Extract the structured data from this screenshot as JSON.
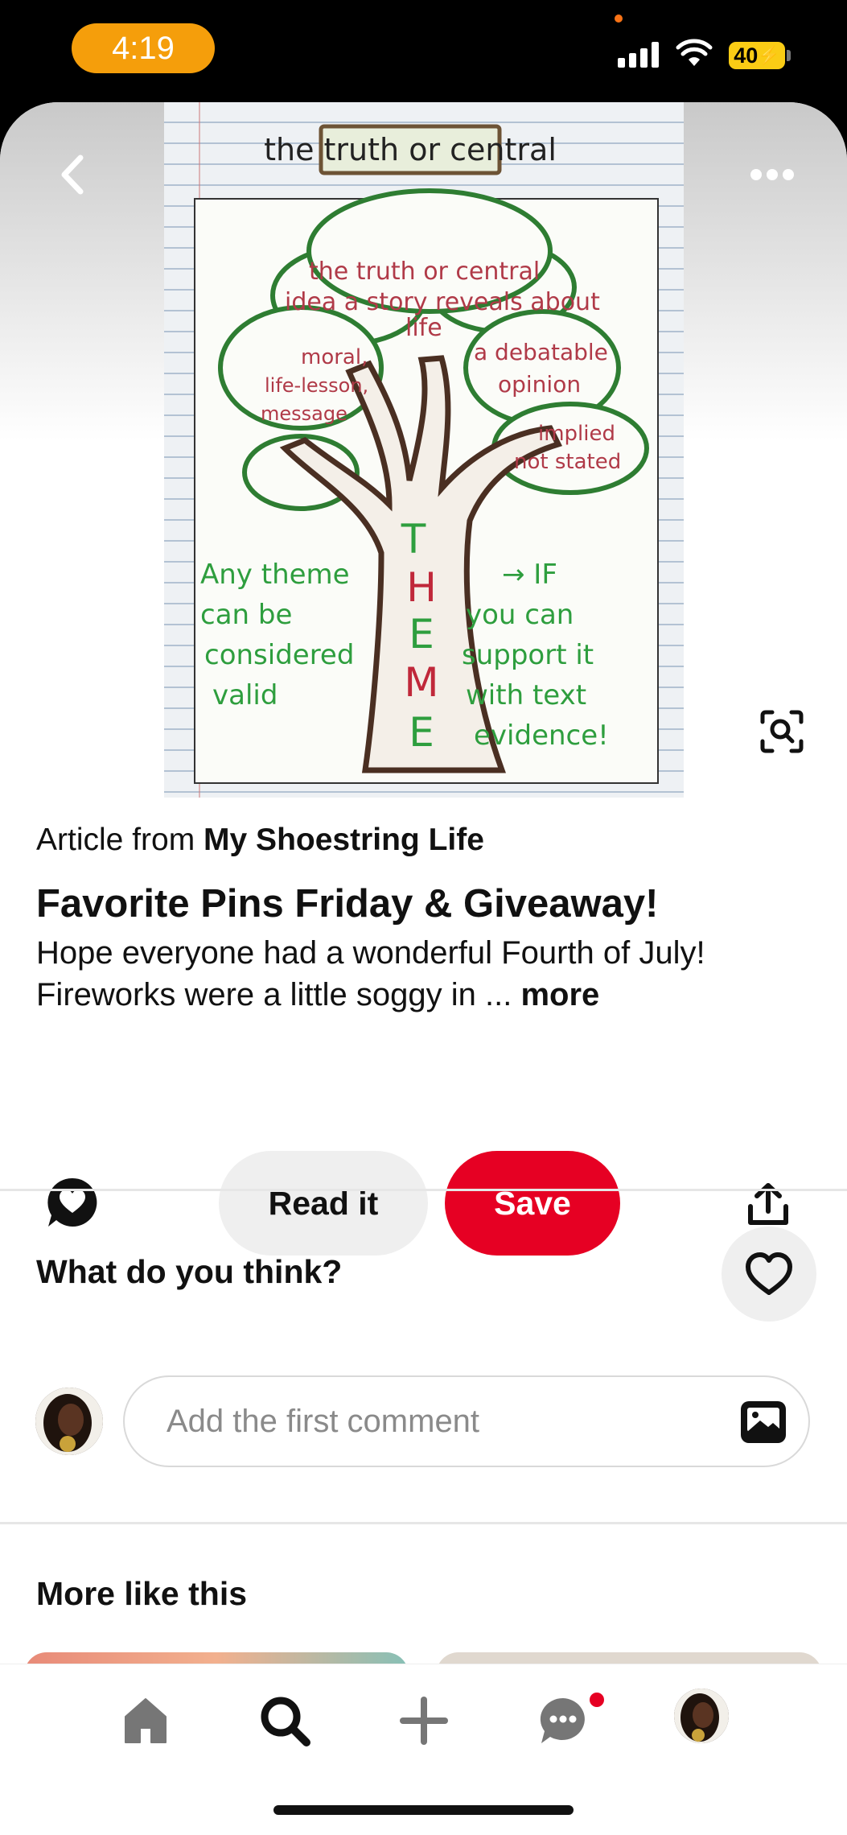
{
  "status_bar": {
    "time": "4:19",
    "battery": "40"
  },
  "pin": {
    "image": {
      "label": "Theme",
      "words": [
        "the truth or central",
        "idea a story reveals about",
        "life",
        "moral,",
        "life-lesson,",
        "message",
        "a debatable",
        "opinion",
        "implied",
        "not stated",
        "Any theme",
        "can be",
        "considered",
        "valid",
        "IF",
        "you can",
        "support it",
        "with text",
        "evidence!",
        "T",
        "H",
        "E",
        "M",
        "E"
      ]
    },
    "article_from_prefix": "Article from",
    "source": "My Shoestring Life",
    "title": "Favorite Pins Friday & Giveaway!",
    "description": "Hope everyone had a wonderful Fourth of July! Fireworks were a little soggy in ...",
    "more_label": "more",
    "read_label": "Read it",
    "save_label": "Save"
  },
  "comments": {
    "heading": "What do you think?",
    "placeholder": "Add the first comment"
  },
  "more_like_this": {
    "heading": "More like this"
  },
  "tabs": [
    "home",
    "search",
    "create",
    "messages",
    "profile"
  ],
  "colors": {
    "accent": "#e60023",
    "time_pill": "#f59e0b",
    "battery": "#facc15"
  }
}
